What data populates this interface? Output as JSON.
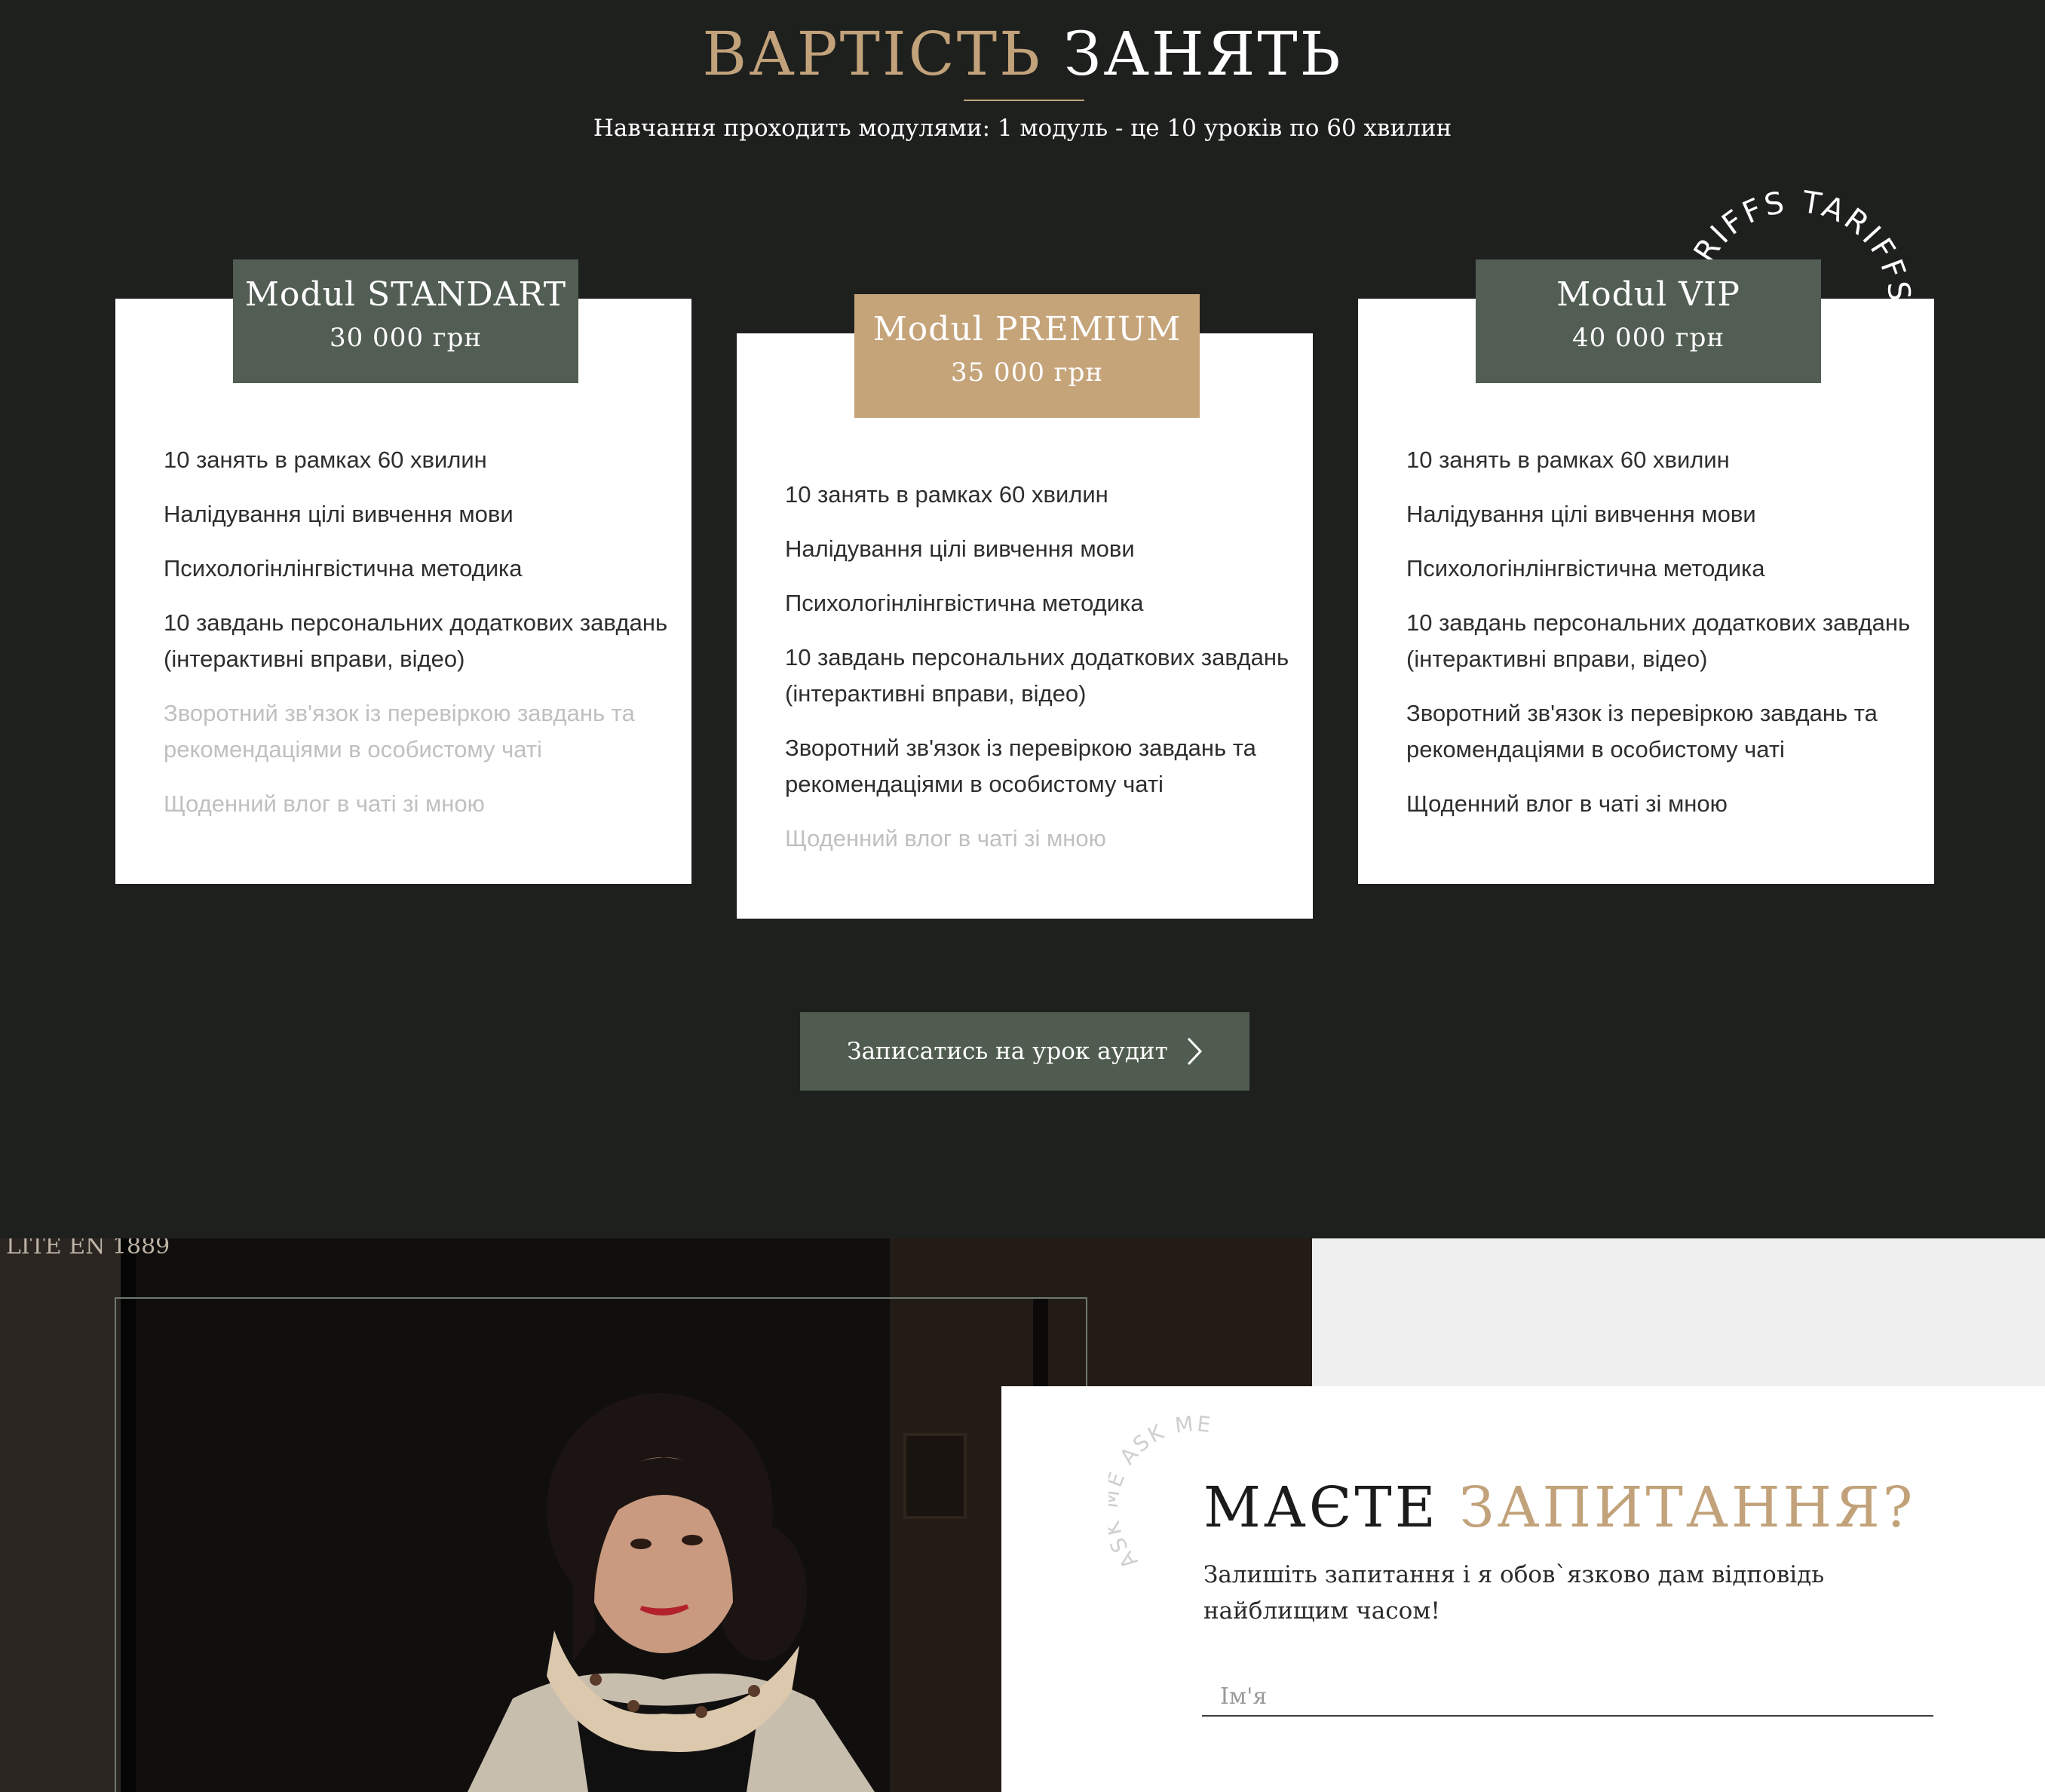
{
  "pricing": {
    "title_accent": "ВАРТІСТЬ",
    "title_main": "ЗАНЯТЬ",
    "subtitle": "Навчання проходить модулями: 1 модуль - це 10 уроків по 60 хвилин",
    "badge_text": "TARIFFS  TARIFFS",
    "cards": [
      {
        "name": "Modul STANDART",
        "price": "30 000 грн",
        "features": [
          {
            "text": "10 занять в рамках 60 хвилин",
            "included": true
          },
          {
            "text": "Налідування цілі вивчення мови",
            "included": true
          },
          {
            "text": "Психологінлінгвістична методика",
            "included": true
          },
          {
            "text": "10 завдань персональних додаткових завдань (інтерактивні вправи, відео)",
            "included": true
          },
          {
            "text": "Зворотний зв'язок із перевіркою завдань та рекомендаціями в особистому чаті",
            "included": false
          },
          {
            "text": "Щоденний влог в чаті зі мною",
            "included": false
          }
        ]
      },
      {
        "name": "Modul PREMIUM",
        "price": "35 000 грн",
        "features": [
          {
            "text": "10 занять в рамках 60 хвилин",
            "included": true
          },
          {
            "text": "Налідування цілі вивчення мови",
            "included": true
          },
          {
            "text": "Психологінлінгвістична методика",
            "included": true
          },
          {
            "text": "10 завдань персональних додаткових завдань (інтерактивні вправи, відео)",
            "included": true
          },
          {
            "text": "Зворотний зв'язок із перевіркою завдань та рекомендаціями в особистому чаті",
            "included": true
          },
          {
            "text": "Щоденний влог в чаті зі мною",
            "included": false
          }
        ]
      },
      {
        "name": "Modul VIP",
        "price": "40 000 грн",
        "features": [
          {
            "text": "10 занять в рамках 60 хвилин",
            "included": true
          },
          {
            "text": "Налідування цілі вивчення мови",
            "included": true
          },
          {
            "text": "Психологінлінгвістична методика",
            "included": true
          },
          {
            "text": "10 завдань персональних додаткових завдань (інтерактивні вправи, відео)",
            "included": true
          },
          {
            "text": "Зворотний зв'язок із перевіркою завдань та рекомендаціями в особистому чаті",
            "included": true
          },
          {
            "text": "Щоденний влог в чаті зі мною",
            "included": true
          }
        ]
      }
    ],
    "cta_label": "Записатись на урок аудит",
    "cta_icon": "chevron-right-icon"
  },
  "contact": {
    "photo_sign_text": "LITE EN 1889",
    "badge_text": "ASK ME  ASK ME",
    "title_main": "МАЄТЕ",
    "title_accent": "ЗАПИТАННЯ?",
    "subtitle": "Залишіть запитання і я обов`язково дам відповідь найблищим часом!",
    "name_placeholder": "Ім'я"
  },
  "colors": {
    "background_dark": "#1e201e",
    "accent_gold": "#c2a27a",
    "card_head_green": "#525e53",
    "card_head_gold": "#c6a47a",
    "button_green": "#4f5c4f",
    "disabled_text": "#c0c0c0"
  }
}
